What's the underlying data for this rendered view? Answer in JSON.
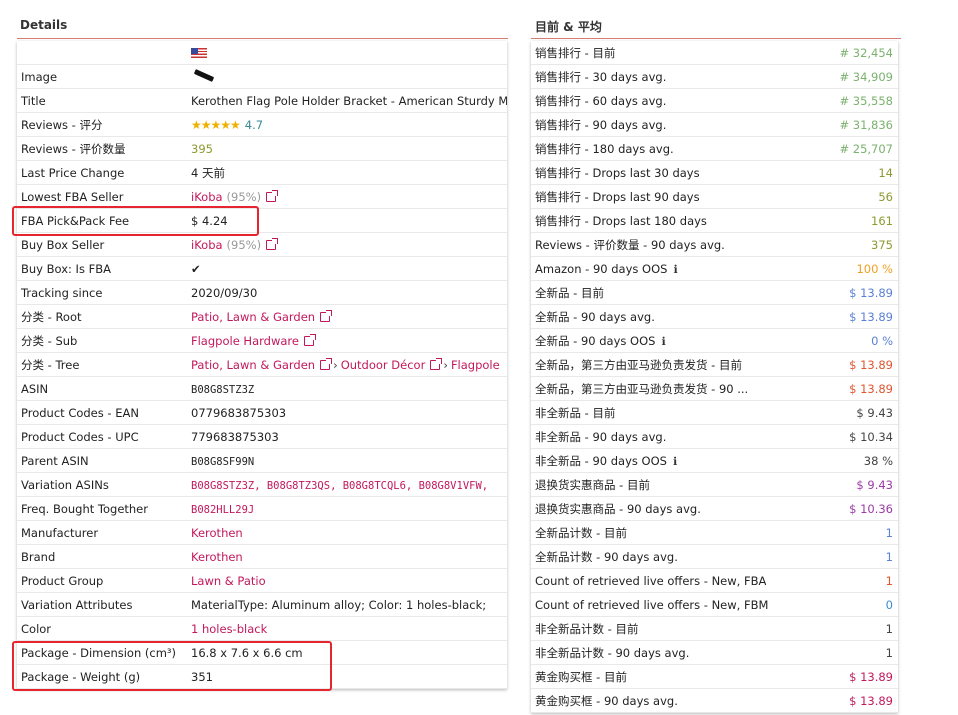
{
  "left": {
    "title": "Details",
    "flag_label": "",
    "rows": [
      {
        "label": "Image",
        "value": ""
      },
      {
        "label": "Title",
        "value": "Kerothen Flag Pole Holder Bracket - American Sturdy Multi"
      },
      {
        "label": "Reviews - 评分",
        "stars": "★★★★★",
        "value": "4.7"
      },
      {
        "label": "Reviews - 评价数量",
        "value": "395"
      },
      {
        "label": "Last Price Change",
        "value": "4 天前"
      },
      {
        "label": "Lowest FBA Seller",
        "value": "iKoba",
        "extra": "(95%)"
      },
      {
        "label": "FBA Pick&Pack Fee",
        "value": "$ 4.24"
      },
      {
        "label": "Buy Box Seller",
        "value": "iKoba",
        "extra": "(95%)"
      },
      {
        "label": "Buy Box: Is FBA",
        "value": "✔"
      },
      {
        "label": "Tracking since",
        "value": "2020/09/30"
      },
      {
        "label": "分类 - Root",
        "value": "Patio, Lawn & Garden"
      },
      {
        "label": "分类 - Sub",
        "value": "Flagpole Hardware"
      },
      {
        "label": "分类 - Tree",
        "tree": [
          "Patio, Lawn & Garden",
          "Outdoor Décor",
          "Flagpole"
        ],
        "sep": "›"
      },
      {
        "label": "ASIN",
        "value": "B08G8STZ3Z"
      },
      {
        "label": "Product Codes - EAN",
        "value": "0779683875303"
      },
      {
        "label": "Product Codes - UPC",
        "value": "779683875303"
      },
      {
        "label": "Parent ASIN",
        "value": "B08G8SF99N"
      },
      {
        "label": "Variation ASINs",
        "value": "B08G8STZ3Z, B08G8TZ3QS, B08G8TCQL6, B08G8V1VFW,"
      },
      {
        "label": "Freq. Bought Together",
        "value": "B082HLL29J"
      },
      {
        "label": "Manufacturer",
        "value": "Kerothen"
      },
      {
        "label": "Brand",
        "value": "Kerothen"
      },
      {
        "label": "Product Group",
        "value": "Lawn & Patio"
      },
      {
        "label": "Variation Attributes",
        "value": "MaterialType: Aluminum alloy; Color: 1 holes-black;"
      },
      {
        "label": "Color",
        "value": "1 holes-black"
      },
      {
        "label": "Package - Dimension (cm³)",
        "value": "16.8 x 7.6 x 6.6 cm"
      },
      {
        "label": "Package - Weight (g)",
        "value": "351"
      }
    ]
  },
  "right": {
    "title": "目前 & 平均",
    "rows": [
      {
        "label": "销售排行 - 目前",
        "value": "# 32,454",
        "color": "#7ab26e"
      },
      {
        "label": "销售排行 - 30 days avg.",
        "value": "# 34,909",
        "color": "#7ab26e"
      },
      {
        "label": "销售排行 - 60 days avg.",
        "value": "# 35,558",
        "color": "#7ab26e"
      },
      {
        "label": "销售排行 - 90 days avg.",
        "value": "# 31,836",
        "color": "#7ab26e"
      },
      {
        "label": "销售排行 - 180 days avg.",
        "value": "# 25,707",
        "color": "#7ab26e"
      },
      {
        "label": "销售排行 - Drops last 30 days",
        "value": "14",
        "color": "#8d9a2f"
      },
      {
        "label": "销售排行 - Drops last 90 days",
        "value": "56",
        "color": "#8d9a2f"
      },
      {
        "label": "销售排行 - Drops last 180 days",
        "value": "161",
        "color": "#8d9a2f"
      },
      {
        "label": "Reviews - 评价数量 - 90 days avg.",
        "value": "375",
        "color": "#8d9a2f"
      },
      {
        "label": "Amazon - 90 days OOS",
        "value": "100 %",
        "color": "#f0a020",
        "info": true
      },
      {
        "label": "全新品 - 目前",
        "value": "$ 13.89",
        "color": "#5b7fd6"
      },
      {
        "label": "全新品 - 90 days avg.",
        "value": "$ 13.89",
        "color": "#5b7fd6"
      },
      {
        "label": "全新品 - 90 days OOS",
        "value": "0 %",
        "color": "#5b7fd6",
        "info": true
      },
      {
        "label": "全新品，第三方由亚马逊负责发货 - 目前",
        "value": "$ 13.89",
        "color": "#e0552d"
      },
      {
        "label": "全新品，第三方由亚马逊负责发货 - 90 ...",
        "value": "$ 13.89",
        "color": "#e0552d"
      },
      {
        "label": "非全新品 - 目前",
        "value": "$ 9.43",
        "color": "#444444"
      },
      {
        "label": "非全新品 - 90 days avg.",
        "value": "$ 10.34",
        "color": "#444444"
      },
      {
        "label": "非全新品 - 90 days OOS",
        "value": "38 %",
        "color": "#444444",
        "info": true
      },
      {
        "label": "退换货实惠商品 - 目前",
        "value": "$ 9.43",
        "color": "#9b3aa8"
      },
      {
        "label": "退换货实惠商品 - 90 days avg.",
        "value": "$ 10.36",
        "color": "#9b3aa8"
      },
      {
        "label": "全新品计数 - 目前",
        "value": "1",
        "color": "#5b7fd6"
      },
      {
        "label": "全新品计数 - 90 days avg.",
        "value": "1",
        "color": "#5b7fd6"
      },
      {
        "label": "Count of retrieved live offers - New, FBA",
        "value": "1",
        "color": "#e0552d"
      },
      {
        "label": "Count of retrieved live offers - New, FBM",
        "value": "0",
        "color": "#3a8ad0"
      },
      {
        "label": "非全新品计数 - 目前",
        "value": "1",
        "color": "#444444"
      },
      {
        "label": "非全新品计数 - 90 days avg.",
        "value": "1",
        "color": "#444444"
      },
      {
        "label": "黄金购买框 - 目前",
        "value": "$ 13.89",
        "color": "#c2185b"
      },
      {
        "label": "黄金购买框 - 90 days avg.",
        "value": "$ 13.89",
        "color": "#c2185b"
      }
    ]
  }
}
